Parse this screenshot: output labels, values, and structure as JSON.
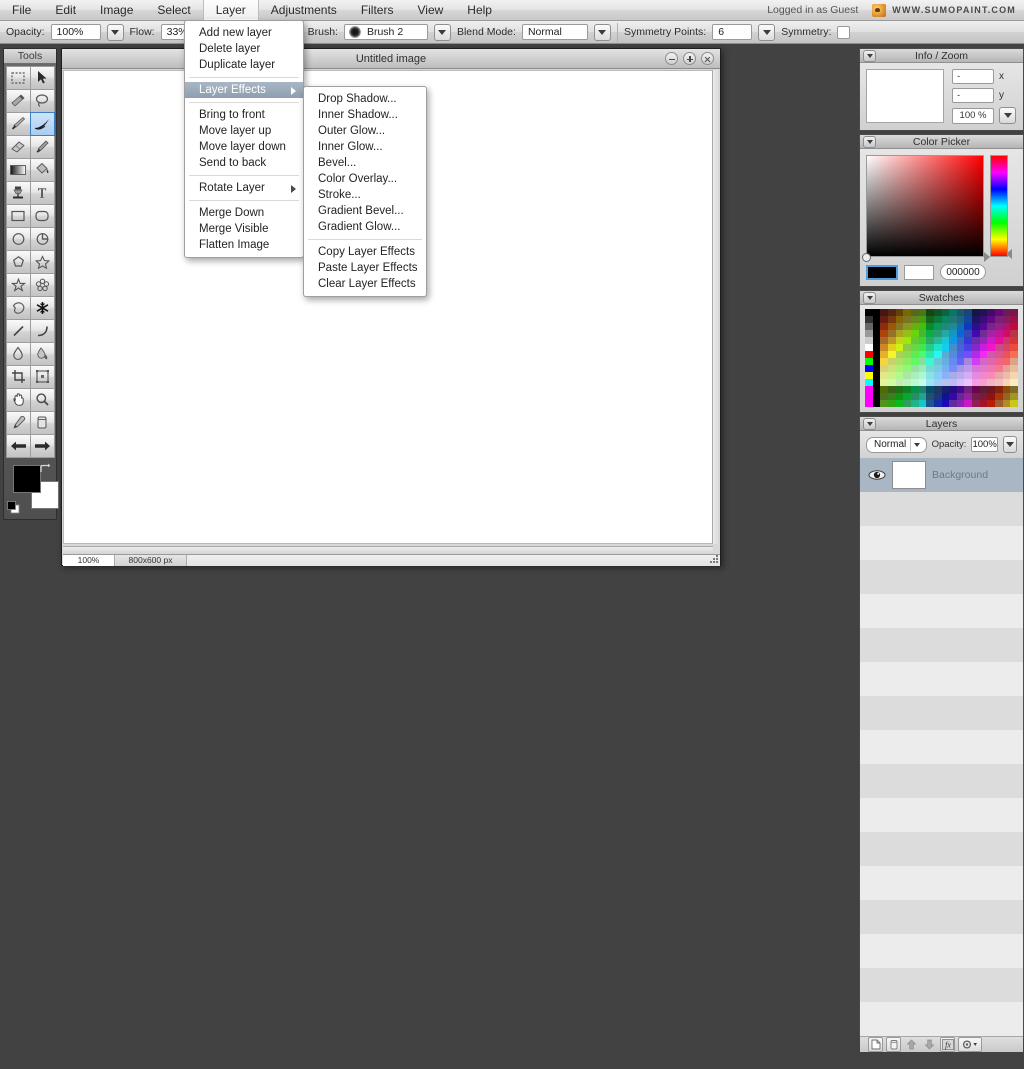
{
  "menubar": {
    "items": [
      {
        "label": "File",
        "active": false
      },
      {
        "label": "Edit",
        "active": false
      },
      {
        "label": "Image",
        "active": false
      },
      {
        "label": "Select",
        "active": false
      },
      {
        "label": "Layer",
        "active": true
      },
      {
        "label": "Adjustments",
        "active": false
      },
      {
        "label": "Filters",
        "active": false
      },
      {
        "label": "View",
        "active": false
      },
      {
        "label": "Help",
        "active": false
      }
    ],
    "login_status": "Logged in as Guest",
    "brand": "WWW.SUMOPAINT.COM"
  },
  "options_bar": {
    "opacity_label": "Opacity:",
    "opacity_value": "100%",
    "flow_label": "Flow:",
    "flow_value": "33%",
    "brush_label": "Brush:",
    "brush_value": "Brush 2",
    "blend_mode_label": "Blend Mode:",
    "blend_mode_value": "Normal",
    "symmetry_points_label": "Symmetry Points:",
    "symmetry_points_value": "6",
    "symmetry_label": "Symmetry:",
    "symmetry_checked": false
  },
  "tools": {
    "title": "Tools",
    "items": [
      {
        "name": "marquee-select-tool",
        "selected": false
      },
      {
        "name": "move-tool",
        "selected": false
      },
      {
        "name": "magic-wand-tool",
        "selected": false
      },
      {
        "name": "lasso-tool",
        "selected": false
      },
      {
        "name": "paint-brush-tool",
        "selected": false
      },
      {
        "name": "ink-brush-tool",
        "selected": true
      },
      {
        "name": "eraser-tool",
        "selected": false
      },
      {
        "name": "smudge-tool",
        "selected": false
      },
      {
        "name": "gradient-tool",
        "selected": false
      },
      {
        "name": "paint-bucket-tool",
        "selected": false
      },
      {
        "name": "clone-stamp-tool",
        "selected": false
      },
      {
        "name": "text-tool",
        "selected": false
      },
      {
        "name": "rectangle-tool",
        "selected": false
      },
      {
        "name": "rounded-rectangle-tool",
        "selected": false
      },
      {
        "name": "ellipse-tool",
        "selected": false
      },
      {
        "name": "pie-tool",
        "selected": false
      },
      {
        "name": "polygon-tool",
        "selected": false
      },
      {
        "name": "star-tool",
        "selected": false
      },
      {
        "name": "star-outline-tool",
        "selected": false
      },
      {
        "name": "flower-tool",
        "selected": false
      },
      {
        "name": "blob-tool",
        "selected": false
      },
      {
        "name": "snowflake-tool",
        "selected": false
      },
      {
        "name": "line-tool",
        "selected": false
      },
      {
        "name": "curve-tool",
        "selected": false
      },
      {
        "name": "water-drop-tool",
        "selected": false
      },
      {
        "name": "blur-tool",
        "selected": false
      },
      {
        "name": "crop-tool",
        "selected": false
      },
      {
        "name": "transform-tool",
        "selected": false
      },
      {
        "name": "hand-tool",
        "selected": false
      },
      {
        "name": "zoom-tool",
        "selected": false
      },
      {
        "name": "eyedropper-tool",
        "selected": false
      },
      {
        "name": "delete-tool",
        "selected": false
      },
      {
        "name": "arrow-left-tool",
        "selected": false
      },
      {
        "name": "arrow-right-tool",
        "selected": false
      }
    ],
    "foreground_color": "#000000",
    "background_color": "#ffffff"
  },
  "layer_menu": {
    "items": [
      {
        "label": "Add new layer",
        "type": "item"
      },
      {
        "label": "Delete layer",
        "type": "item"
      },
      {
        "label": "Duplicate layer",
        "type": "item"
      },
      {
        "type": "separator"
      },
      {
        "label": "Layer Effects",
        "type": "submenu",
        "highlighted": true
      },
      {
        "type": "separator"
      },
      {
        "label": "Bring to front",
        "type": "item"
      },
      {
        "label": "Move layer up",
        "type": "item"
      },
      {
        "label": "Move layer down",
        "type": "item"
      },
      {
        "label": "Send to back",
        "type": "item"
      },
      {
        "type": "separator"
      },
      {
        "label": "Rotate Layer",
        "type": "submenu"
      },
      {
        "type": "separator"
      },
      {
        "label": "Merge Down",
        "type": "item"
      },
      {
        "label": "Merge Visible",
        "type": "item"
      },
      {
        "label": "Flatten Image",
        "type": "item"
      }
    ]
  },
  "effects_menu": {
    "items": [
      {
        "label": "Drop Shadow...",
        "type": "item"
      },
      {
        "label": "Inner Shadow...",
        "type": "item"
      },
      {
        "label": "Outer Glow...",
        "type": "item"
      },
      {
        "label": "Inner Glow...",
        "type": "item"
      },
      {
        "label": "Bevel...",
        "type": "item"
      },
      {
        "label": "Color Overlay...",
        "type": "item"
      },
      {
        "label": "Stroke...",
        "type": "item"
      },
      {
        "label": "Gradient Bevel...",
        "type": "item"
      },
      {
        "label": "Gradient Glow...",
        "type": "item"
      },
      {
        "type": "separator"
      },
      {
        "label": "Copy Layer Effects",
        "type": "item"
      },
      {
        "label": "Paste Layer Effects",
        "type": "item"
      },
      {
        "label": "Clear Layer Effects",
        "type": "item"
      }
    ]
  },
  "canvas_window": {
    "title": "Untitled image",
    "zoom_status": "100%",
    "size_status": "800x600 px"
  },
  "panels": {
    "info_zoom": {
      "title": "Info / Zoom",
      "x_value": "-",
      "x_label": "x",
      "y_value": "-",
      "y_label": "y",
      "zoom_value": "100 %"
    },
    "color_picker": {
      "title": "Color Picker",
      "foreground": "#000000",
      "background": "#ffffff",
      "hex_value": "000000",
      "hue_color": "#ff0000"
    },
    "swatches": {
      "title": "Swatches"
    },
    "layers": {
      "title": "Layers",
      "blend_mode": "Normal",
      "opacity_label": "Opacity:",
      "opacity_value": "100%",
      "items": [
        {
          "name": "Background",
          "visible": true,
          "selected": true
        }
      ],
      "footer_buttons": [
        {
          "name": "new-layer-button"
        },
        {
          "name": "delete-layer-button"
        },
        {
          "name": "move-layer-up-button"
        },
        {
          "name": "move-layer-down-button"
        },
        {
          "name": "layer-effects-button"
        },
        {
          "name": "layer-settings-button"
        }
      ]
    }
  }
}
